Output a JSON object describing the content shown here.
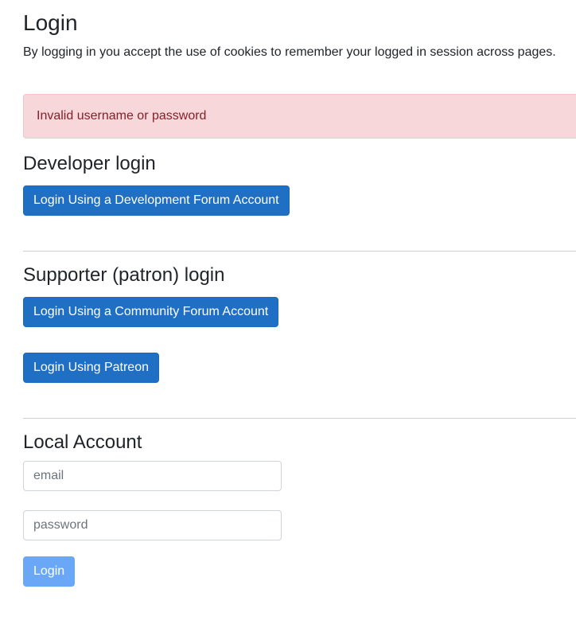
{
  "page": {
    "title": "Login",
    "intro": "By logging in you accept the use of cookies to remember your logged in session across pages."
  },
  "alert": {
    "message": "Invalid username or password",
    "color": "#842029",
    "background": "#f8d7da"
  },
  "developer": {
    "heading": "Developer login",
    "dev_forum_button": "Login Using a Development Forum Account"
  },
  "supporter": {
    "heading": "Supporter (patron) login",
    "community_forum_button": "Login Using a Community Forum Account",
    "patreon_button": "Login Using Patreon"
  },
  "local": {
    "heading": "Local Account",
    "email_placeholder": "email",
    "password_placeholder": "password",
    "login_button": "Login",
    "login_button_state": "disabled"
  },
  "colors": {
    "primary": "#1f6fc5",
    "primary_disabled": "#6aa8f7"
  }
}
